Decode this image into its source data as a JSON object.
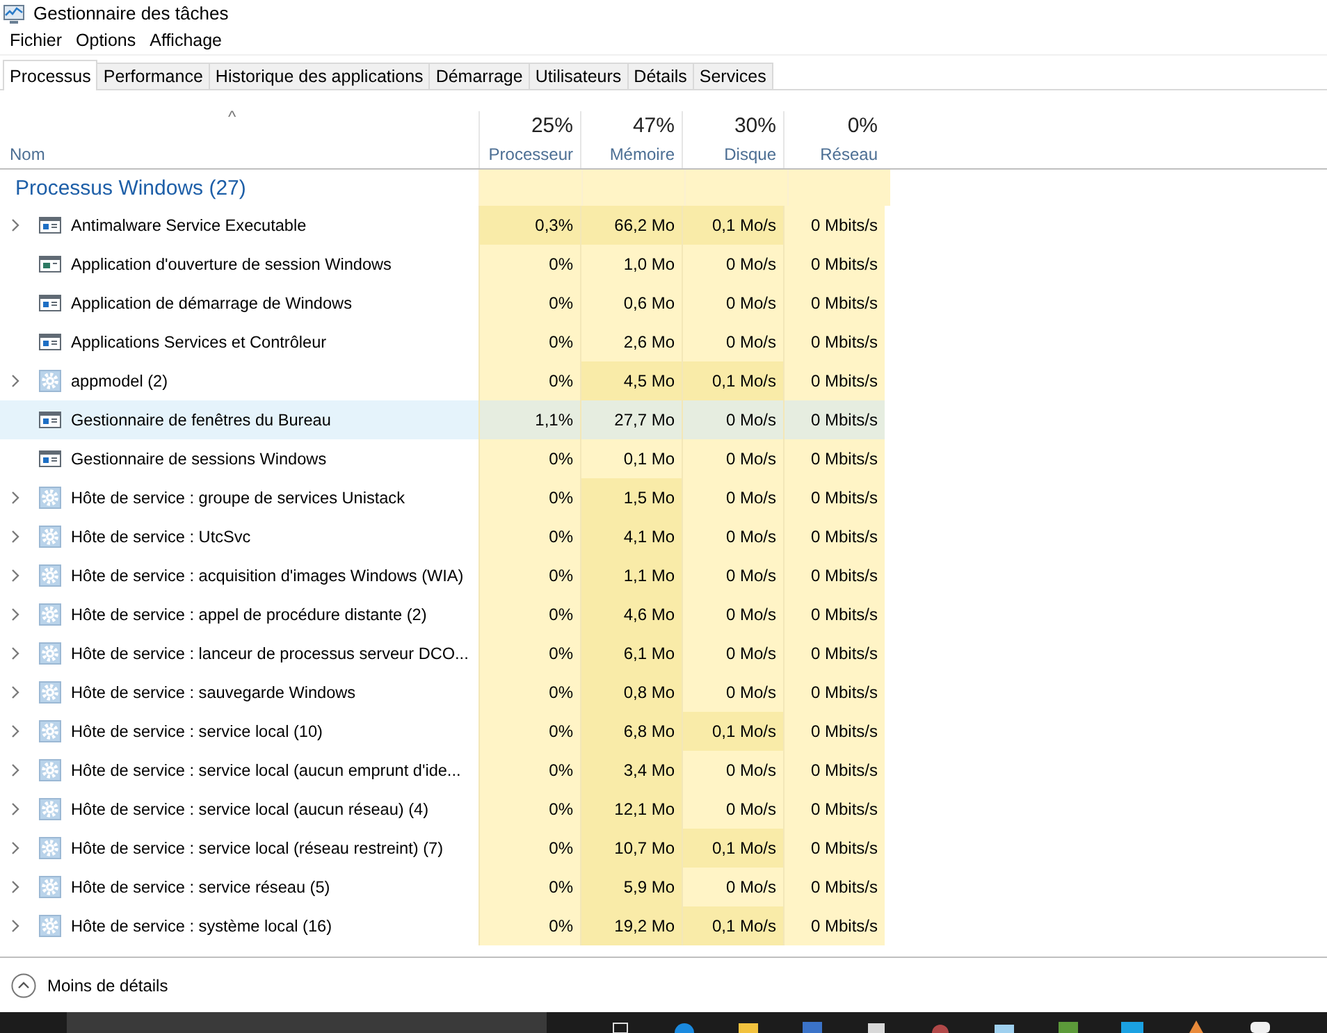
{
  "window": {
    "title": "Gestionnaire des tâches"
  },
  "menu": [
    "Fichier",
    "Options",
    "Affichage"
  ],
  "tabs": [
    {
      "label": "Processus",
      "selected": true
    },
    {
      "label": "Performance",
      "selected": false
    },
    {
      "label": "Historique des applications",
      "selected": false
    },
    {
      "label": "Démarrage",
      "selected": false
    },
    {
      "label": "Utilisateurs",
      "selected": false
    },
    {
      "label": "Détails",
      "selected": false
    },
    {
      "label": "Services",
      "selected": false
    }
  ],
  "table": {
    "sort_indicator": "^",
    "name_column": "Nom",
    "columns": [
      {
        "total": "25%",
        "label": "Processeur"
      },
      {
        "total": "47%",
        "label": "Mémoire"
      },
      {
        "total": "30%",
        "label": "Disque"
      },
      {
        "total": "0%",
        "label": "Réseau"
      }
    ],
    "group": "Processus Windows (27)",
    "rows": [
      {
        "name": "Antimalware Service Executable",
        "kind": "app",
        "expandable": true,
        "hovered": false,
        "cells": [
          {
            "value": "0,3%",
            "highlighted": true
          },
          {
            "value": "66,2 Mo",
            "highlighted": true
          },
          {
            "value": "0,1 Mo/s",
            "highlighted": true
          },
          {
            "value": "0 Mbits/s",
            "highlighted": false
          }
        ]
      },
      {
        "name": "Application d'ouverture de session Windows",
        "kind": "logon",
        "expandable": false,
        "hovered": false,
        "cells": [
          {
            "value": "0%",
            "highlighted": false
          },
          {
            "value": "1,0 Mo",
            "highlighted": false
          },
          {
            "value": "0 Mo/s",
            "highlighted": false
          },
          {
            "value": "0 Mbits/s",
            "highlighted": false
          }
        ]
      },
      {
        "name": "Application de démarrage de Windows",
        "kind": "app",
        "expandable": false,
        "hovered": false,
        "cells": [
          {
            "value": "0%",
            "highlighted": false
          },
          {
            "value": "0,6 Mo",
            "highlighted": false
          },
          {
            "value": "0 Mo/s",
            "highlighted": false
          },
          {
            "value": "0 Mbits/s",
            "highlighted": false
          }
        ]
      },
      {
        "name": "Applications Services et Contrôleur",
        "kind": "app",
        "expandable": false,
        "hovered": false,
        "cells": [
          {
            "value": "0%",
            "highlighted": false
          },
          {
            "value": "2,6 Mo",
            "highlighted": false
          },
          {
            "value": "0 Mo/s",
            "highlighted": false
          },
          {
            "value": "0 Mbits/s",
            "highlighted": false
          }
        ]
      },
      {
        "name": "appmodel (2)",
        "kind": "service",
        "expandable": true,
        "hovered": false,
        "cells": [
          {
            "value": "0%",
            "highlighted": false
          },
          {
            "value": "4,5 Mo",
            "highlighted": true
          },
          {
            "value": "0,1 Mo/s",
            "highlighted": true
          },
          {
            "value": "0 Mbits/s",
            "highlighted": false
          }
        ]
      },
      {
        "name": "Gestionnaire de fenêtres du Bureau",
        "kind": "app",
        "expandable": false,
        "hovered": true,
        "cells": [
          {
            "value": "1,1%"
          },
          {
            "value": "27,7 Mo"
          },
          {
            "value": "0 Mo/s"
          },
          {
            "value": "0 Mbits/s"
          }
        ]
      },
      {
        "name": "Gestionnaire de sessions Windows",
        "kind": "app",
        "expandable": false,
        "hovered": false,
        "cells": [
          {
            "value": "0%",
            "highlighted": false
          },
          {
            "value": "0,1 Mo",
            "highlighted": false
          },
          {
            "value": "0 Mo/s",
            "highlighted": false
          },
          {
            "value": "0 Mbits/s",
            "highlighted": false
          }
        ]
      },
      {
        "name": "Hôte de service : groupe de services Unistack",
        "kind": "service",
        "expandable": true,
        "hovered": false,
        "cells": [
          {
            "value": "0%",
            "highlighted": false
          },
          {
            "value": "1,5 Mo",
            "highlighted": true
          },
          {
            "value": "0 Mo/s",
            "highlighted": false
          },
          {
            "value": "0 Mbits/s",
            "highlighted": false
          }
        ]
      },
      {
        "name": "Hôte de service : UtcSvc",
        "kind": "service",
        "expandable": true,
        "hovered": false,
        "cells": [
          {
            "value": "0%",
            "highlighted": false
          },
          {
            "value": "4,1 Mo",
            "highlighted": true
          },
          {
            "value": "0 Mo/s",
            "highlighted": false
          },
          {
            "value": "0 Mbits/s",
            "highlighted": false
          }
        ]
      },
      {
        "name": "Hôte de service : acquisition d'images Windows (WIA)",
        "kind": "service",
        "expandable": true,
        "hovered": false,
        "cells": [
          {
            "value": "0%",
            "highlighted": false
          },
          {
            "value": "1,1 Mo",
            "highlighted": true
          },
          {
            "value": "0 Mo/s",
            "highlighted": false
          },
          {
            "value": "0 Mbits/s",
            "highlighted": false
          }
        ]
      },
      {
        "name": "Hôte de service : appel de procédure distante (2)",
        "kind": "service",
        "expandable": true,
        "hovered": false,
        "cells": [
          {
            "value": "0%",
            "highlighted": false
          },
          {
            "value": "4,6 Mo",
            "highlighted": true
          },
          {
            "value": "0 Mo/s",
            "highlighted": false
          },
          {
            "value": "0 Mbits/s",
            "highlighted": false
          }
        ]
      },
      {
        "name": "Hôte de service : lanceur de processus serveur DCO...",
        "kind": "service",
        "expandable": true,
        "hovered": false,
        "cells": [
          {
            "value": "0%",
            "highlighted": false
          },
          {
            "value": "6,1 Mo",
            "highlighted": true
          },
          {
            "value": "0 Mo/s",
            "highlighted": false
          },
          {
            "value": "0 Mbits/s",
            "highlighted": false
          }
        ]
      },
      {
        "name": "Hôte de service : sauvegarde Windows",
        "kind": "service",
        "expandable": true,
        "hovered": false,
        "cells": [
          {
            "value": "0%",
            "highlighted": false
          },
          {
            "value": "0,8 Mo",
            "highlighted": true
          },
          {
            "value": "0 Mo/s",
            "highlighted": false
          },
          {
            "value": "0 Mbits/s",
            "highlighted": false
          }
        ]
      },
      {
        "name": "Hôte de service : service local (10)",
        "kind": "service",
        "expandable": true,
        "hovered": false,
        "cells": [
          {
            "value": "0%",
            "highlighted": false
          },
          {
            "value": "6,8 Mo",
            "highlighted": true
          },
          {
            "value": "0,1 Mo/s",
            "highlighted": true
          },
          {
            "value": "0 Mbits/s",
            "highlighted": false
          }
        ]
      },
      {
        "name": "Hôte de service : service local (aucun emprunt d'ide...",
        "kind": "service",
        "expandable": true,
        "hovered": false,
        "cells": [
          {
            "value": "0%",
            "highlighted": false
          },
          {
            "value": "3,4 Mo",
            "highlighted": true
          },
          {
            "value": "0 Mo/s",
            "highlighted": false
          },
          {
            "value": "0 Mbits/s",
            "highlighted": false
          }
        ]
      },
      {
        "name": "Hôte de service : service local (aucun réseau) (4)",
        "kind": "service",
        "expandable": true,
        "hovered": false,
        "cells": [
          {
            "value": "0%",
            "highlighted": false
          },
          {
            "value": "12,1 Mo",
            "highlighted": true
          },
          {
            "value": "0 Mo/s",
            "highlighted": false
          },
          {
            "value": "0 Mbits/s",
            "highlighted": false
          }
        ]
      },
      {
        "name": "Hôte de service : service local (réseau restreint) (7)",
        "kind": "service",
        "expandable": true,
        "hovered": false,
        "cells": [
          {
            "value": "0%",
            "highlighted": false
          },
          {
            "value": "10,7 Mo",
            "highlighted": true
          },
          {
            "value": "0,1 Mo/s",
            "highlighted": true
          },
          {
            "value": "0 Mbits/s",
            "highlighted": false
          }
        ]
      },
      {
        "name": "Hôte de service : service réseau (5)",
        "kind": "service",
        "expandable": true,
        "hovered": false,
        "cells": [
          {
            "value": "0%",
            "highlighted": false
          },
          {
            "value": "5,9 Mo",
            "highlighted": true
          },
          {
            "value": "0 Mo/s",
            "highlighted": false
          },
          {
            "value": "0 Mbits/s",
            "highlighted": false
          }
        ]
      },
      {
        "name": "Hôte de service : système local (16)",
        "kind": "service",
        "expandable": true,
        "hovered": false,
        "cells": [
          {
            "value": "0%",
            "highlighted": false
          },
          {
            "value": "19,2 Mo",
            "highlighted": true
          },
          {
            "value": "0,1 Mo/s",
            "highlighted": true
          },
          {
            "value": "0 Mbits/s",
            "highlighted": false
          }
        ]
      }
    ]
  },
  "footer": {
    "label": "Moins de détails"
  }
}
